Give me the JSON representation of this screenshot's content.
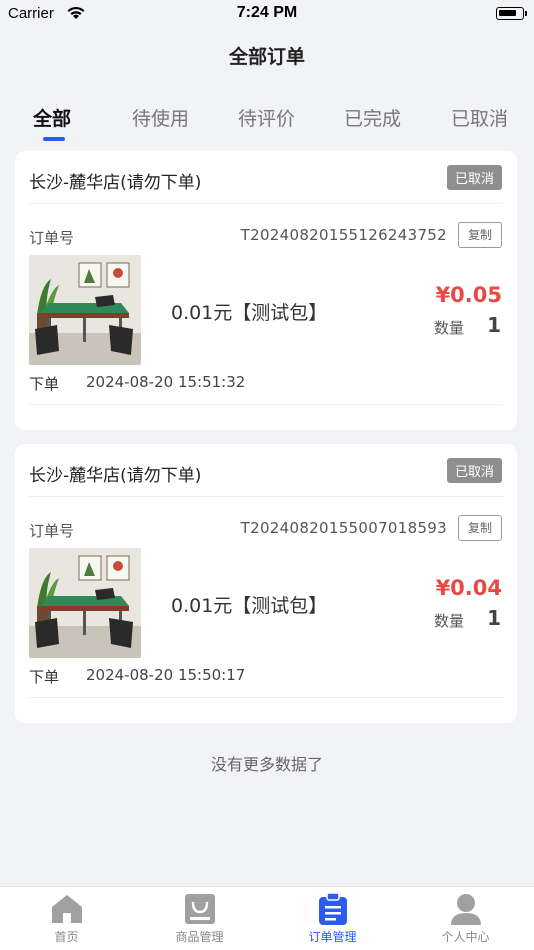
{
  "status_bar": {
    "carrier": "Carrier",
    "time": "7:24 PM"
  },
  "header": {
    "title": "全部订单"
  },
  "tabs": [
    {
      "label": "全部",
      "active": true
    },
    {
      "label": "待使用",
      "active": false
    },
    {
      "label": "待评价",
      "active": false
    },
    {
      "label": "已完成",
      "active": false
    },
    {
      "label": "已取消",
      "active": false
    }
  ],
  "orders": [
    {
      "store": "长沙-麓华店(请勿下单)",
      "status": "已取消",
      "order_no_label": "订单号",
      "order_no": "T20240820155126243752",
      "copy_label": "复制",
      "product": "0.01元【测试包】",
      "price": "¥0.05",
      "qty_label": "数量",
      "qty": "1",
      "time_label": "下单",
      "time": "2024-08-20 15:51:32"
    },
    {
      "store": "长沙-麓华店(请勿下单)",
      "status": "已取消",
      "order_no_label": "订单号",
      "order_no": "T20240820155007018593",
      "copy_label": "复制",
      "product": "0.01元【测试包】",
      "price": "¥0.04",
      "qty_label": "数量",
      "qty": "1",
      "time_label": "下单",
      "time": "2024-08-20 15:50:17"
    }
  ],
  "footer": {
    "no_more": "没有更多数据了"
  },
  "tabbar": [
    {
      "label": "首页",
      "icon": "home-icon",
      "active": false
    },
    {
      "label": "商品管理",
      "icon": "goods-icon",
      "active": false
    },
    {
      "label": "订单管理",
      "icon": "clipboard-icon",
      "active": true
    },
    {
      "label": "个人中心",
      "icon": "user-icon",
      "active": false
    }
  ],
  "colors": {
    "accent": "#2c5bf0",
    "price": "#e84a43",
    "badge": "#8e8e8e",
    "background": "#f2f3f7",
    "inactive_icon": "#a0a0a0"
  }
}
